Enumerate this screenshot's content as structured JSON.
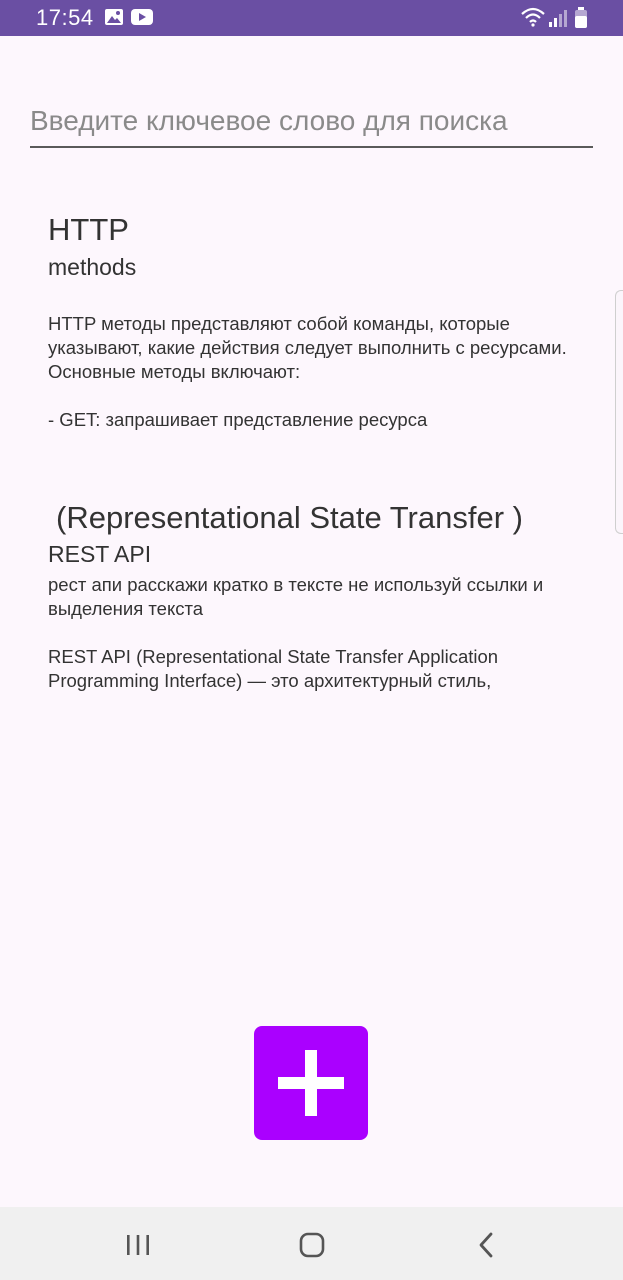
{
  "status_bar": {
    "time": "17:54",
    "color": "#6a4fa3",
    "icons": [
      "gallery-icon",
      "youtube-icon",
      "wifi-icon",
      "signal-icon",
      "battery-icon"
    ]
  },
  "search": {
    "placeholder": "Введите ключевое слово для поиска",
    "value": ""
  },
  "notes": [
    {
      "title": "HTTP",
      "subtitle": "methods",
      "body": "HTTP методы представляют собой команды, которые указывают, какие действия следует выполнить с ресурсами. Основные методы включают:\n\n- GET: запрашивает представление ресурса"
    },
    {
      "title": "(Representational State Transfer )",
      "subtitle": "REST API",
      "body": "рест апи расскажи кратко в тексте не используй ссылки и выделения текста\n\nREST API (Representational State Transfer Application Programming Interface) — это архитектурный стиль,"
    }
  ],
  "add_button": {
    "icon": "plus-icon",
    "color": "#aa00ff"
  },
  "nav_bar": {
    "buttons": [
      "recents-icon",
      "home-icon",
      "back-icon"
    ]
  }
}
